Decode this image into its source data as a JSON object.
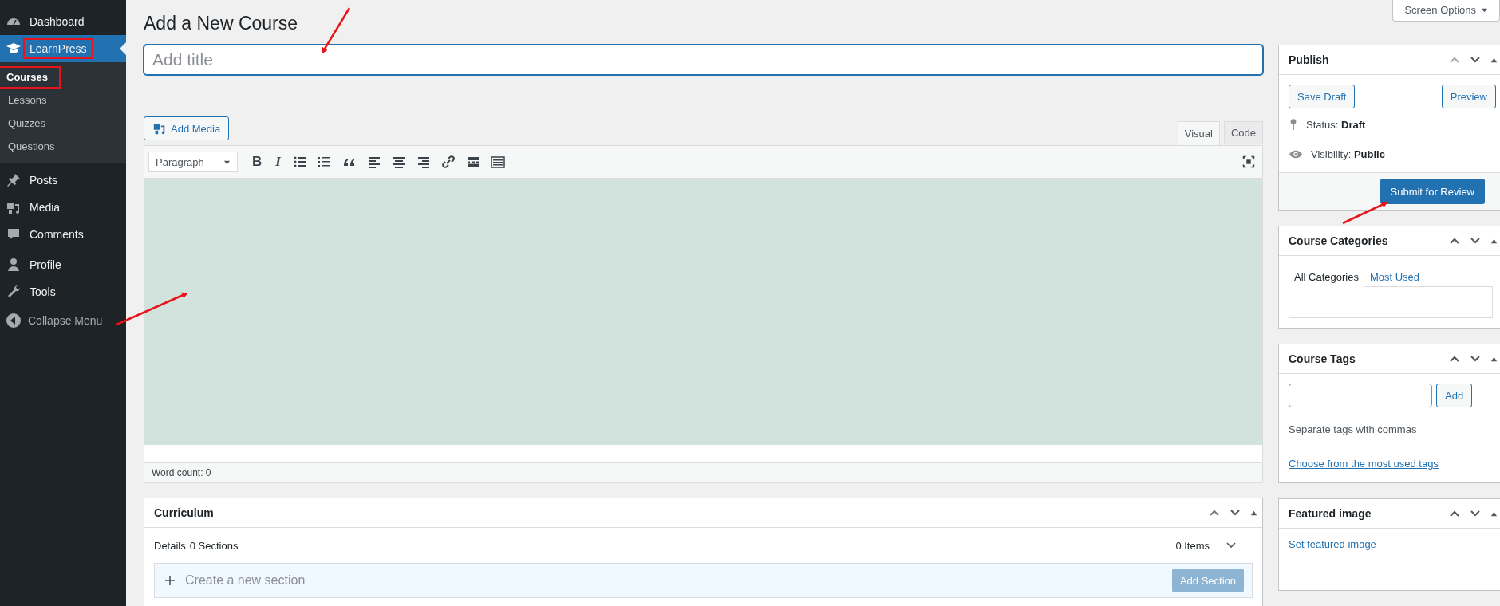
{
  "sidebar": {
    "items": [
      {
        "label": "Dashboard",
        "selected": false,
        "highlighted": false
      },
      {
        "label": "LearnPress",
        "selected": true,
        "highlighted": true,
        "children": [
          {
            "label": "Courses",
            "selected": true,
            "highlighted": true
          },
          {
            "label": "Lessons",
            "selected": false,
            "highlighted": false
          },
          {
            "label": "Quizzes",
            "selected": false,
            "highlighted": false
          },
          {
            "label": "Questions",
            "selected": false,
            "highlighted": false
          }
        ]
      },
      {
        "label": "Posts",
        "selected": false,
        "highlighted": false
      },
      {
        "label": "Media",
        "selected": false,
        "highlighted": false
      },
      {
        "label": "Comments",
        "selected": false,
        "highlighted": false
      },
      {
        "label": "Profile",
        "selected": false,
        "highlighted": false
      },
      {
        "label": "Tools",
        "selected": false,
        "highlighted": false
      }
    ],
    "collapse_label": "Collapse Menu"
  },
  "screen_options": "Screen Options",
  "page_title": "Add a New Course",
  "title_field": {
    "placeholder": "Add title"
  },
  "editor": {
    "add_media": "Add Media",
    "tabs": [
      {
        "label": "Visual",
        "selected": true
      },
      {
        "label": "Code",
        "selected": false
      }
    ],
    "format": "Paragraph",
    "bold": "B",
    "italic": "I",
    "word_count": "Word count: 0"
  },
  "curriculum": {
    "title": "Curriculum",
    "details": "Details",
    "sections": "0 Sections",
    "items": "0 Items",
    "new_section": {
      "placeholder": "Create a new section"
    },
    "add_section": {
      "label": "Add Section",
      "disabled": true
    }
  },
  "publish": {
    "title": "Publish",
    "save_draft": "Save Draft",
    "preview": "Preview",
    "status_label": "Status:",
    "status_value": "Draft",
    "visibility_label": "Visibility:",
    "visibility_value": "Public",
    "submit": "Submit for Review"
  },
  "categories": {
    "title": "Course Categories",
    "tabs": [
      {
        "label": "All Categories",
        "selected": true
      },
      {
        "label": "Most Used",
        "selected": false
      }
    ]
  },
  "tags": {
    "title": "Course Tags",
    "add": "Add",
    "hint": "Separate tags with commas",
    "link": "Choose from the most used tags"
  },
  "featured": {
    "title": "Featured image",
    "link": "Set featured image"
  }
}
